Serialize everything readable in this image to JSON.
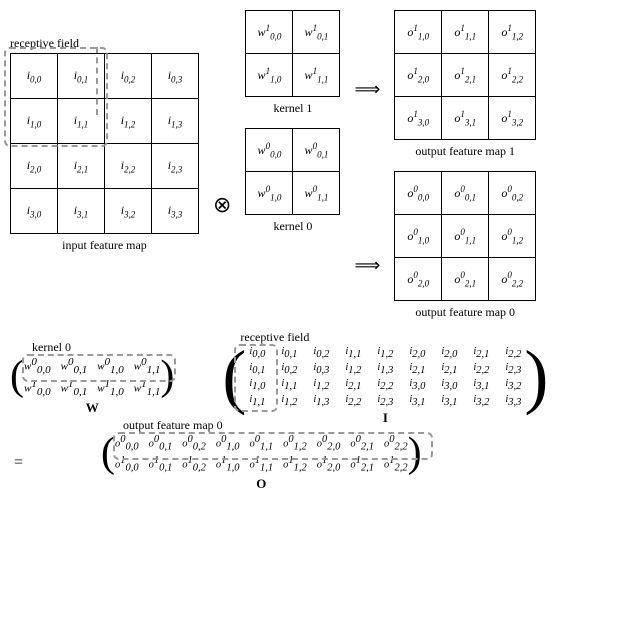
{
  "labels": {
    "receptive_field": "receptive field",
    "input": "input feature map",
    "kernel1": "kernel 1",
    "kernel0": "kernel 0",
    "out1": "output feature map 1",
    "out0": "output feature map 0",
    "conv": "⊗",
    "arrow": "⟹",
    "W": "W",
    "I": "I",
    "O": "O",
    "eq": "="
  },
  "input_map": [
    [
      "i0,0",
      "i0,1",
      "i0,2",
      "i0,3"
    ],
    [
      "i1,0",
      "i1,1",
      "i1,2",
      "i1,3"
    ],
    [
      "i2,0",
      "i2,1",
      "i2,2",
      "i2,3"
    ],
    [
      "i3,0",
      "i3,1",
      "i3,2",
      "i3,3"
    ]
  ],
  "kernel1": [
    [
      "w0,0^1",
      "w0,1^1"
    ],
    [
      "w1,0^1",
      "w1,1^1"
    ]
  ],
  "kernel0": [
    [
      "w0,0^0",
      "w0,1^0"
    ],
    [
      "w1,0^0",
      "w1,1^0"
    ]
  ],
  "output1": [
    [
      "o1,0^1",
      "o1,1^1",
      "o1,2^1"
    ],
    [
      "o2,0^1",
      "o2,1^1",
      "o2,2^1"
    ],
    [
      "o3,0^1",
      "o3,1^1",
      "o3,2^1"
    ]
  ],
  "output0": [
    [
      "o0,0^0",
      "o0,1^0",
      "o0,2^0"
    ],
    [
      "o1,0^0",
      "o1,1^0",
      "o1,2^0"
    ],
    [
      "o2,0^0",
      "o2,1^0",
      "o2,2^0"
    ]
  ],
  "W_matrix": [
    [
      "w0,0^0",
      "w0,1^0",
      "w1,0^0",
      "w1,1^0"
    ],
    [
      "w0,0^1",
      "w0,1^1",
      "w1,0^1",
      "w1,1^1"
    ]
  ],
  "I_matrix": [
    [
      "i0,0",
      "i0,1",
      "i0,2",
      "i1,1",
      "i1,2",
      "i2,0",
      "i2,0",
      "i2,1",
      "i2,2"
    ],
    [
      "i0,1",
      "i0,2",
      "i0,3",
      "i1,2",
      "i1,3",
      "i2,1",
      "i2,1",
      "i2,2",
      "i2,3"
    ],
    [
      "i1,0",
      "i1,1",
      "i1,2",
      "i2,1",
      "i2,2",
      "i3,0",
      "i3,0",
      "i3,1",
      "i3,2"
    ],
    [
      "i1,1",
      "i1,2",
      "i1,3",
      "i2,2",
      "i2,3",
      "i3,1",
      "i3,1",
      "i3,2",
      "i3,3"
    ]
  ],
  "O_matrix": [
    [
      "o0,0^0",
      "o0,1^0",
      "o0,2^0",
      "o1,0^0",
      "o1,1^0",
      "o1,2^0",
      "o2,0^0",
      "o2,1^0",
      "o2,2^0"
    ],
    [
      "o0,0^1",
      "o0,1^1",
      "o0,2^1",
      "o1,0^1",
      "o1,1^1",
      "o1,2^1",
      "o2,0^1",
      "o2,1^1",
      "o2,2^1"
    ]
  ],
  "annot": {
    "kernel0_label": "kernel 0",
    "receptive_label": "receptive field",
    "out0_label": "output feature map 0"
  }
}
